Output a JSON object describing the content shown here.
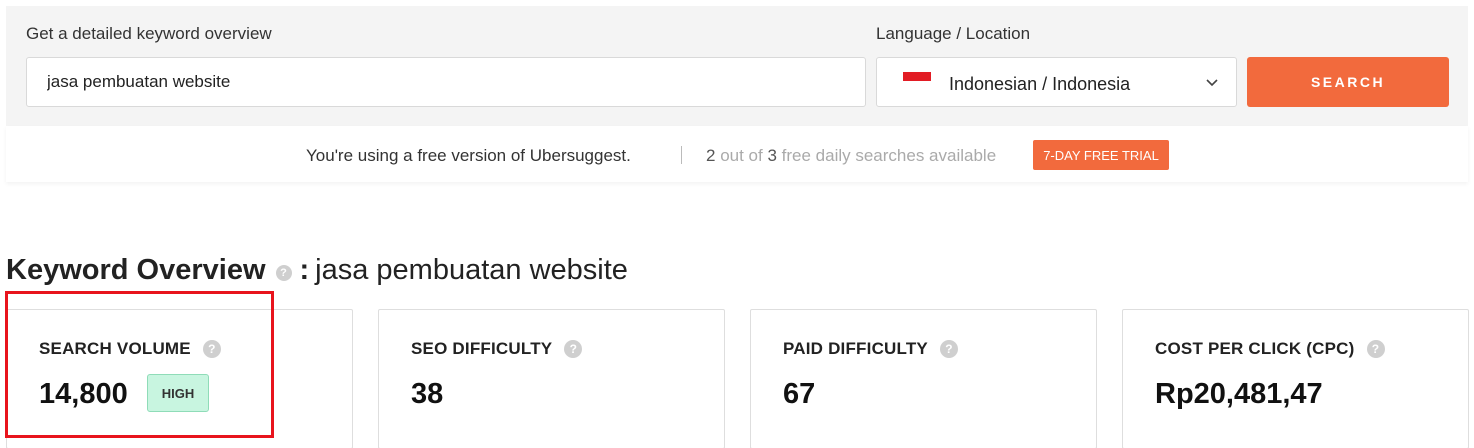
{
  "search": {
    "keyword_label": "Get a detailed keyword overview",
    "keyword_value": "jasa pembuatan website",
    "language_label": "Language / Location",
    "language_value": "Indonesian / Indonesia",
    "button_label": "SEARCH"
  },
  "notice": {
    "text": "You're using a free version of Ubersuggest.",
    "used": "2",
    "out_of": " out of ",
    "total": "3",
    "suffix": " free daily searches available",
    "trial_label": "7-DAY FREE TRIAL"
  },
  "overview": {
    "title": "Keyword Overview",
    "help": "?",
    "colon": ":",
    "keyword": "jasa pembuatan website"
  },
  "cards": [
    {
      "title": "SEARCH VOLUME",
      "value": "14,800",
      "badge": "HIGH"
    },
    {
      "title": "SEO DIFFICULTY",
      "value": "38"
    },
    {
      "title": "PAID DIFFICULTY",
      "value": "67"
    },
    {
      "title": "COST PER CLICK (CPC)",
      "value": "Rp20,481,47"
    }
  ],
  "colors": {
    "accent": "#f26a3d",
    "highlight": "#e8141d",
    "badge_bg": "#c8f5e0"
  },
  "icons": {
    "flag": "indonesia-flag-icon",
    "dropdown": "chevron-down-icon",
    "help": "help-icon"
  }
}
